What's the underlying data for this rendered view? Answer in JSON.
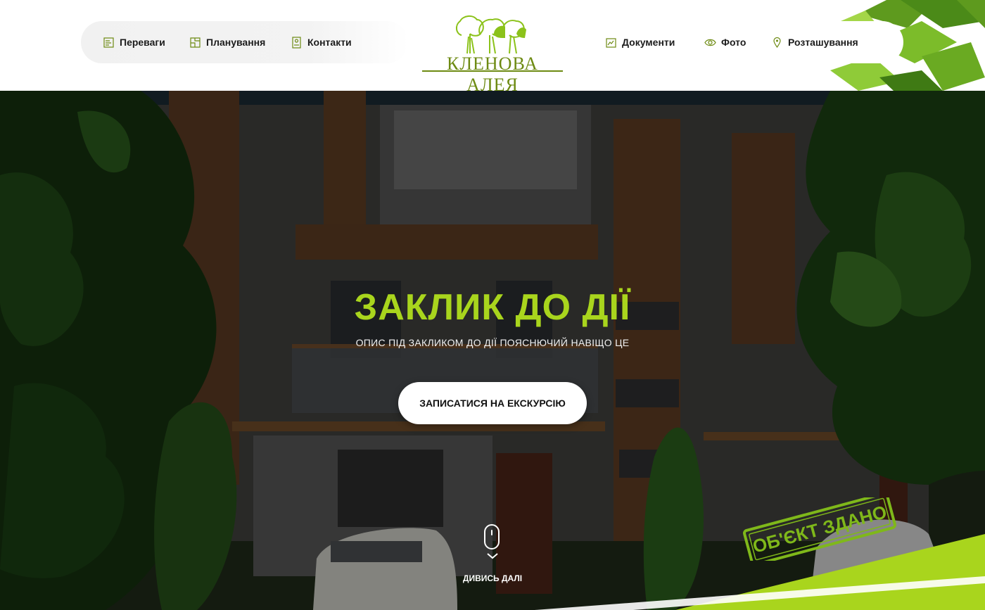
{
  "header": {
    "nav_left": [
      {
        "label": "Переваги",
        "icon": "advantages-icon"
      },
      {
        "label": "Планування",
        "icon": "floorplan-icon"
      },
      {
        "label": "Контакти",
        "icon": "contacts-icon"
      }
    ],
    "nav_right": [
      {
        "label": "Документи",
        "icon": "documents-icon"
      },
      {
        "label": "Фото",
        "icon": "eye-icon"
      },
      {
        "label": "Розташування",
        "icon": "map-pin-icon"
      }
    ],
    "logo_text": "КЛЕНОВА АЛЕЯ"
  },
  "hero": {
    "title": "ЗАКЛИК ДО ДІЇ",
    "subtitle": "ОПИС ПІД ЗАКЛИКОМ ДО ДІЇ ПОЯСНЮЧИЙ НАВІЩО ЦЕ",
    "cta_label": "ЗАПИСАТИСЯ НА ЕКСКУРСІЮ",
    "scroll_label": "ДИВИСЬ ДАЛІ",
    "stamp_text": "ОБ'ЄКТ ЗДАНО"
  },
  "colors": {
    "accent": "#a9d51d",
    "logo_green": "#6d8a12",
    "stamp_green": "#7fb81a",
    "nav_text": "#1c1c1c"
  }
}
